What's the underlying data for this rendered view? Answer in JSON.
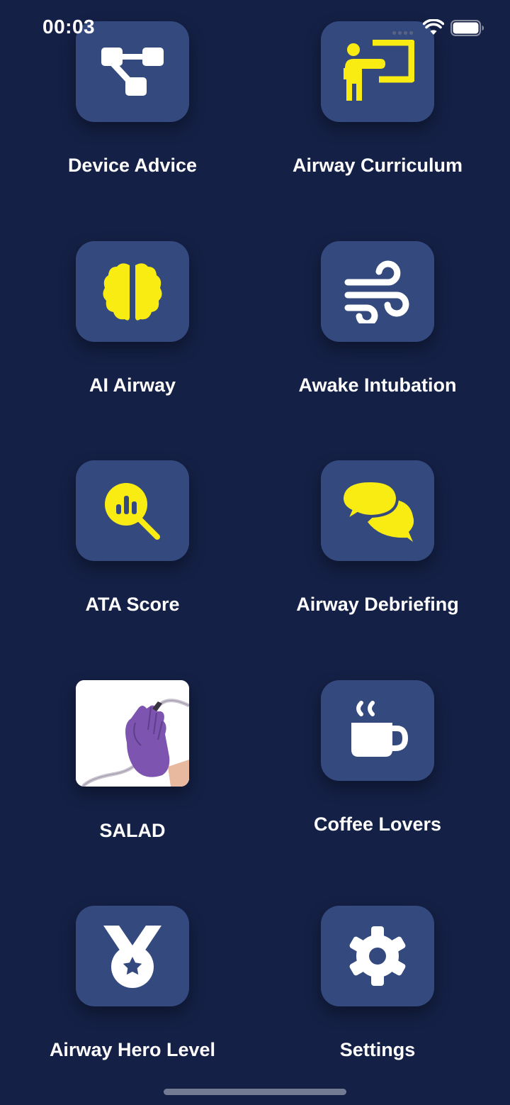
{
  "status_bar": {
    "time": "00:03"
  },
  "colors": {
    "background": "#142045",
    "tile": "#344a7e",
    "accent_yellow": "#f9ec13",
    "icon_white": "#ffffff",
    "glove_purple": "#7d55b0"
  },
  "menu": {
    "items": [
      {
        "label": "Device Advice",
        "icon": "device-tree-icon"
      },
      {
        "label": "Airway Curriculum",
        "icon": "teacher-board-icon"
      },
      {
        "label": "AI Airway",
        "icon": "brain-icon"
      },
      {
        "label": "Awake Intubation",
        "icon": "wind-icon"
      },
      {
        "label": "ATA Score",
        "icon": "magnifier-chart-icon"
      },
      {
        "label": "Airway Debriefing",
        "icon": "speech-bubbles-icon"
      },
      {
        "label": "SALAD",
        "icon": "gloved-hand-suction-photo"
      },
      {
        "label": "Coffee Lovers",
        "icon": "coffee-cup-icon"
      },
      {
        "label": "Airway Hero Level",
        "icon": "medal-icon"
      },
      {
        "label": "Settings",
        "icon": "gear-icon"
      }
    ]
  }
}
